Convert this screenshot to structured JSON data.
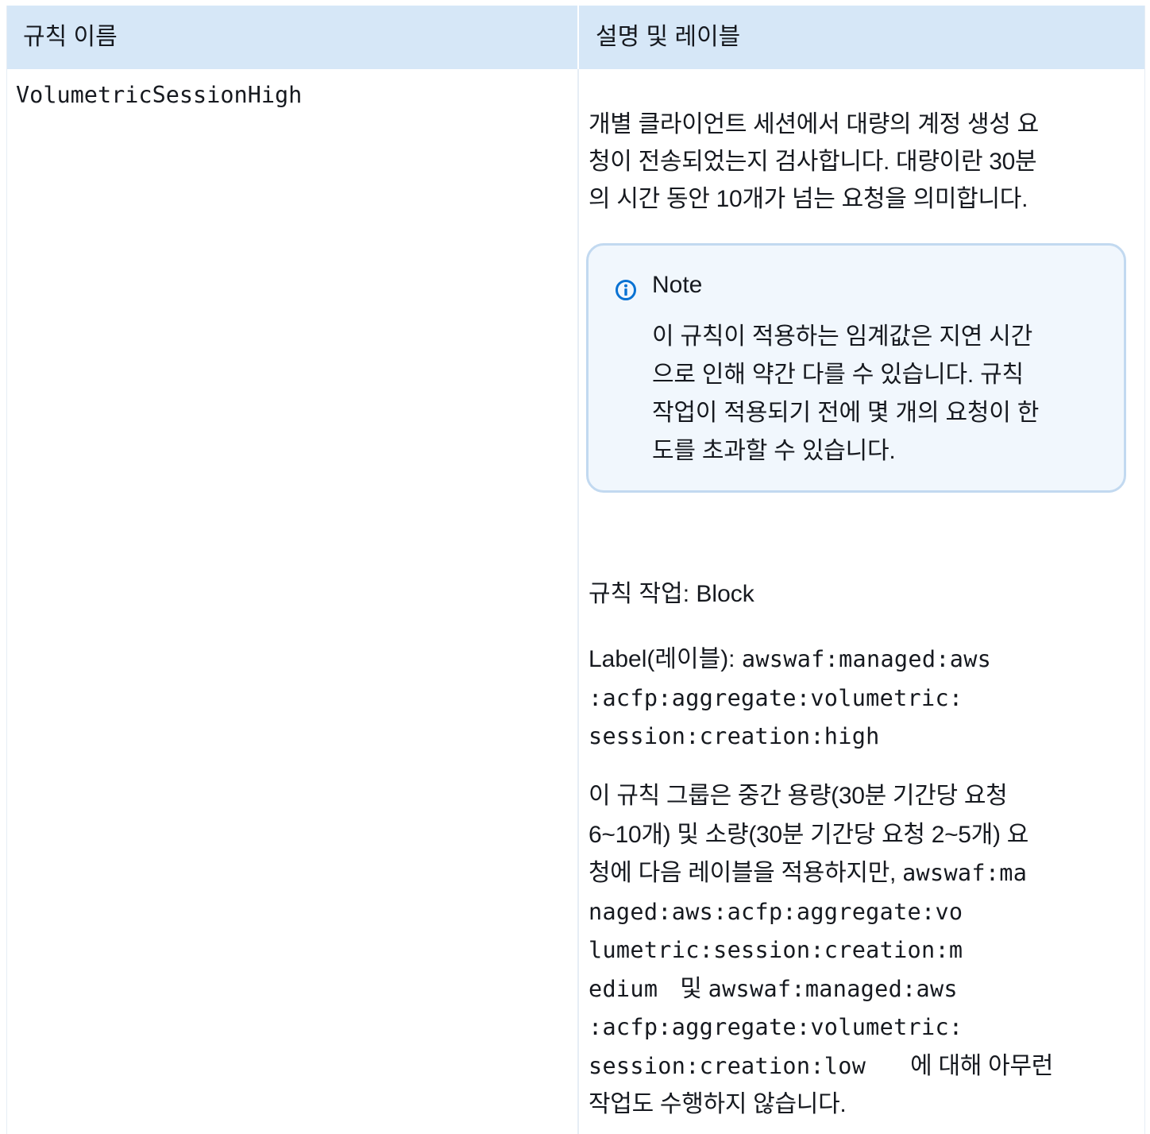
{
  "table": {
    "header": {
      "col_rule_name": "규칙 이름",
      "col_description": "설명 및 레이블"
    },
    "row": {
      "rule_name": "VolumetricSessionHigh",
      "description_lines": [
        "개별 클라이언트 세션에서 대량의 계정 생성 요",
        "청이 전송되었는지 검사합니다. 대량이란 30분",
        "의 시간 동안 10개가 넘는 요청을 의미합니다."
      ],
      "note": {
        "icon": "info-circle-icon",
        "title": "Note",
        "body_lines": [
          "이 규칙이 적용하는 임계값은 지연 시간",
          "으로 인해 약간 다를 수 있습니다. 규칙",
          "작업이 적용되기 전에 몇 개의 요청이 한",
          "도를 초과할 수 있습니다."
        ]
      },
      "rule_action": "규칙 작업: Block",
      "label": {
        "prefix": "Label(레이블): ",
        "code_lines": [
          "awswaf:managed:aws",
          ":acfp:aggregate:volumetric:",
          "session:creation:high"
        ]
      },
      "group_note": {
        "lines": [
          "이 규칙 그룹은 중간 용량(30분 기간당 요청",
          "6~10개) 및 소량(30분 기간당 요청 2~5개) 요",
          "청에 다음 레이블을 적용하지만, "
        ],
        "code_medium_lines": [
          "awswaf:ma",
          "naged:aws:acfp:aggregate:vo",
          "lumetric:session:creation:m",
          "edium"
        ],
        "conjunction": "및 ",
        "code_low_lines": [
          "awswaf:managed:aws",
          ":acfp:aggregate:volumetric:",
          "session:creation:low"
        ],
        "tail_lines": [
          "에 대해 아무런",
          "작업도 수행하지 않습니다."
        ]
      }
    }
  },
  "colors": {
    "header_bg": "#d6e7f7",
    "note_bg": "#f1f7fd",
    "note_border": "#c2d9f0",
    "info_icon": "#0972d3",
    "text": "#16191f"
  }
}
